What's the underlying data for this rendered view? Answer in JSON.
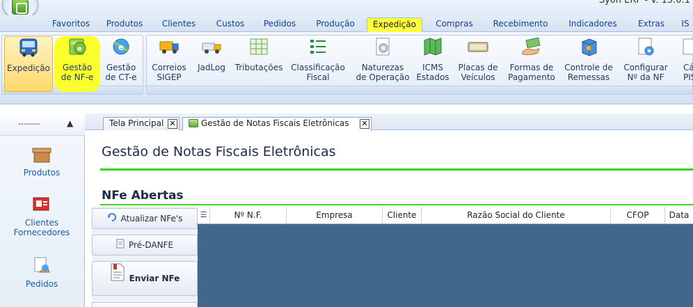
{
  "app": {
    "version_text": "Syon ERP - V. 15.0.1"
  },
  "ribbon_tabs": [
    "Favoritos",
    "Produtos",
    "Clientes",
    "Custos",
    "Pedidos",
    "Produção",
    "Expedição",
    "Compras",
    "Recebimento",
    "Indicadores",
    "Extras",
    "IS"
  ],
  "active_tab": "Expedição",
  "ribbon_buttons": [
    {
      "label": "Expedição",
      "icon": "bus-icon"
    },
    {
      "label": "Gestão\nde NF-e",
      "icon": "nfe-icon"
    },
    {
      "label": "Gestão\nde CT-e",
      "icon": "cte-icon"
    },
    {
      "label": "Correios\nSIGEP",
      "icon": "truck-icon"
    },
    {
      "label": "JadLog",
      "icon": "delivery-truck-icon"
    },
    {
      "label": "Tributações",
      "icon": "grid-table-icon"
    },
    {
      "label": "Classificação\nFiscal",
      "icon": "list-icon"
    },
    {
      "label": "Naturezas\nde Operação",
      "icon": "document-gear-icon"
    },
    {
      "label": "ICMS\nEstados",
      "icon": "map-icon"
    },
    {
      "label": "Placas de\nVeículos",
      "icon": "license-plate-icon"
    },
    {
      "label": "Formas de\nPagamento",
      "icon": "money-hand-icon"
    },
    {
      "label": "Controle de\nRemessas",
      "icon": "box-icon"
    },
    {
      "label": "Configurar\nNº da NF",
      "icon": "config-nf-icon"
    },
    {
      "label": "Cál\nPIS/",
      "icon": "calc-icon"
    }
  ],
  "sidebar": {
    "header_text": "--------",
    "items": [
      {
        "label": "Produtos",
        "icon": "box-icon"
      },
      {
        "label": "Clientes\nFornecedores",
        "icon": "contact-card-icon"
      },
      {
        "label": "Pedidos",
        "icon": "order-icon"
      }
    ]
  },
  "doc_tabs": [
    {
      "label": "Tela Principal"
    },
    {
      "label": "Gestão de Notas Fiscais Eletrônicas"
    }
  ],
  "page_title": "Gestão de Notas Fiscais Eletrônicas",
  "section_title": "NFe Abertas",
  "actions": [
    {
      "label": "Atualizar NFe's",
      "icon": "refresh-icon"
    },
    {
      "label": "Pré-DANFE",
      "icon": "document-icon"
    },
    {
      "label": "Enviar NFe",
      "icon": "send-document-icon"
    }
  ],
  "grid_columns": [
    "Nº N.F.",
    "Empresa",
    "Cliente",
    "Razão Social do Cliente",
    "CFOP",
    "Data"
  ],
  "colors": {
    "highlight": "#ffff3c",
    "accent_green": "#35d41f",
    "grid_bg": "#41688b"
  }
}
